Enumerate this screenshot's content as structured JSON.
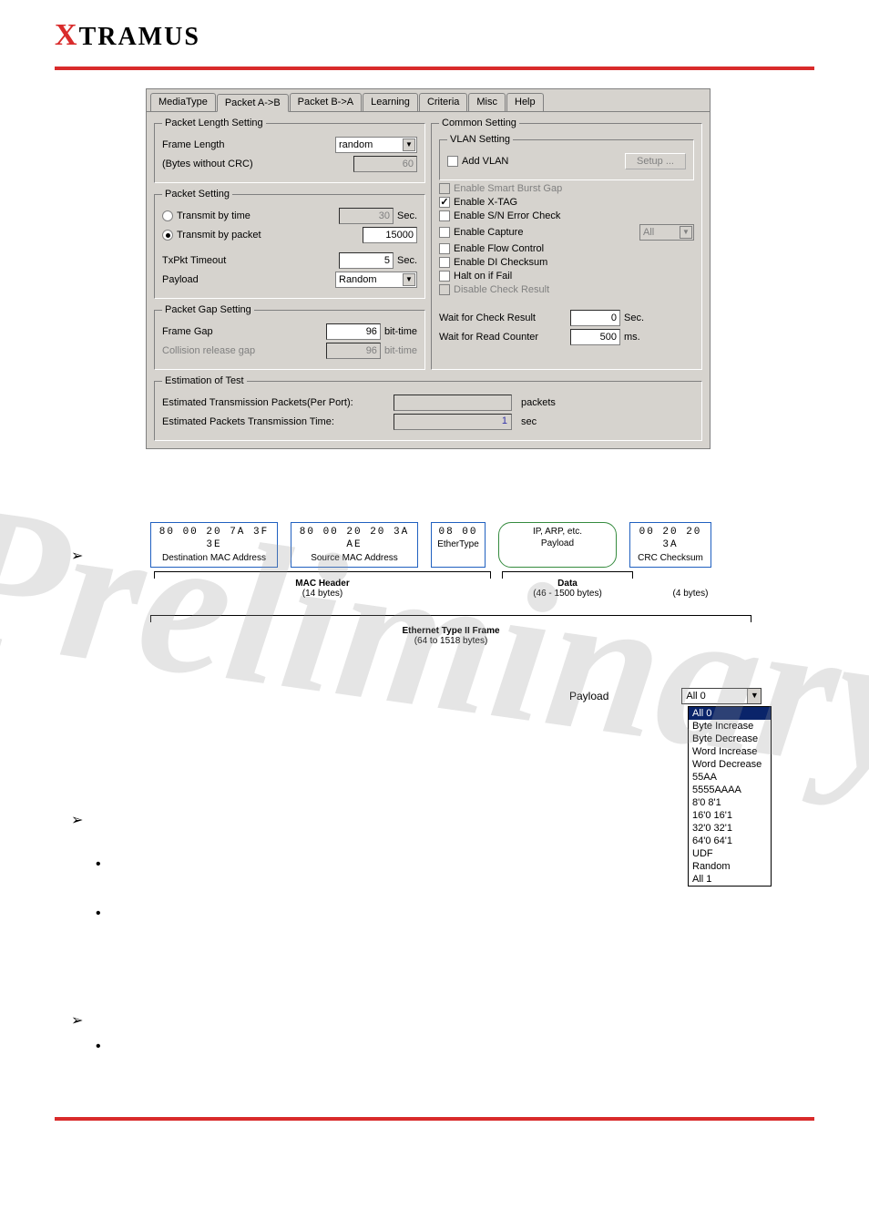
{
  "logo": {
    "x": "X",
    "rest": "TRAMUS"
  },
  "tabs": {
    "mediaType": "MediaType",
    "packetAB": "Packet A->B",
    "packetBA": "Packet B->A",
    "learning": "Learning",
    "criteria": "Criteria",
    "misc": "Misc",
    "help": "Help"
  },
  "packetLength": {
    "legend": "Packet Length Setting",
    "frameLengthLabel": "Frame Length",
    "frameLengthValue": "random",
    "bytesWithoutCrcLabel": "(Bytes without CRC)",
    "bytesWithoutCrcValue": "60"
  },
  "packetSetting": {
    "legend": "Packet Setting",
    "transmitByTime": "Transmit by time",
    "transmitByTimeValue": "30",
    "transmitByPacket": "Transmit by packet",
    "transmitByPacketValue": "15000",
    "txPktTimeout": "TxPkt Timeout",
    "txPktTimeoutValue": "5",
    "payloadLabel": "Payload",
    "payloadValue": "Random",
    "secUnit": "Sec."
  },
  "packetGap": {
    "legend": "Packet Gap Setting",
    "frameGap": "Frame Gap",
    "frameGapValue": "96",
    "collisionRelease": "Collision release gap",
    "collisionReleaseValue": "96",
    "bitTime": "bit-time"
  },
  "common": {
    "legend": "Common Setting",
    "vlanLegend": "VLAN Setting",
    "addVlan": "Add VLAN",
    "setupBtn": "Setup ...",
    "enableSmartBurst": "Enable Smart Burst Gap",
    "enableXtag": "Enable X-TAG",
    "enableSn": "Enable S/N Error Check",
    "enableCapture": "Enable Capture",
    "captureAll": "All",
    "enableFlow": "Enable Flow Control",
    "enableDi": "Enable DI Checksum",
    "haltFail": "Halt on if Fail",
    "disableCheck": "Disable Check Result",
    "waitCheck": "Wait for Check Result",
    "waitCheckVal": "0",
    "waitCheckUnit": "Sec.",
    "waitRead": "Wait for Read Counter",
    "waitReadVal": "500",
    "waitReadUnit": "ms."
  },
  "estimation": {
    "legend": "Estimation of Test",
    "estPkts": "Estimated Transmission Packets(Per Port):",
    "estPktsVal": "",
    "pktsUnit": "packets",
    "estTime": "Estimated Packets Transmission Time:",
    "estTimeVal": "1",
    "secUnit": "sec"
  },
  "frame": {
    "destHex": "80 00 20 7A 3F 3E",
    "destLabel": "Destination MAC Address",
    "srcHex": "80 00 20 20 3A AE",
    "srcLabel": "Source MAC Address",
    "etHex": "08 00",
    "etLabel": "EtherType",
    "payloadTop": "IP, ARP, etc.",
    "payloadLabel": "Payload",
    "crcHex": "00 20 20 3A",
    "crcLabel": "CRC Checksum",
    "macHeader": "MAC Header",
    "macBytes": "(14 bytes)",
    "dataLabel": "Data",
    "dataBytes": "(46 - 1500 bytes)",
    "crcBytes": "(4 bytes)",
    "fullLabel": "Ethernet Type II Frame",
    "fullBytes": "(64 to 1518 bytes)"
  },
  "payloadFig": {
    "label": "Payload",
    "selected": "All 0",
    "options": [
      "All 0",
      "Byte Increase",
      "Byte Decrease",
      "Word Increase",
      "Word Decrease",
      "55AA",
      "5555AAAA",
      "8'0 8'1",
      "16'0 16'1",
      "32'0 32'1",
      "64'0 64'1",
      "UDF",
      "Random",
      "All 1"
    ]
  },
  "watermark": "Preliminary"
}
